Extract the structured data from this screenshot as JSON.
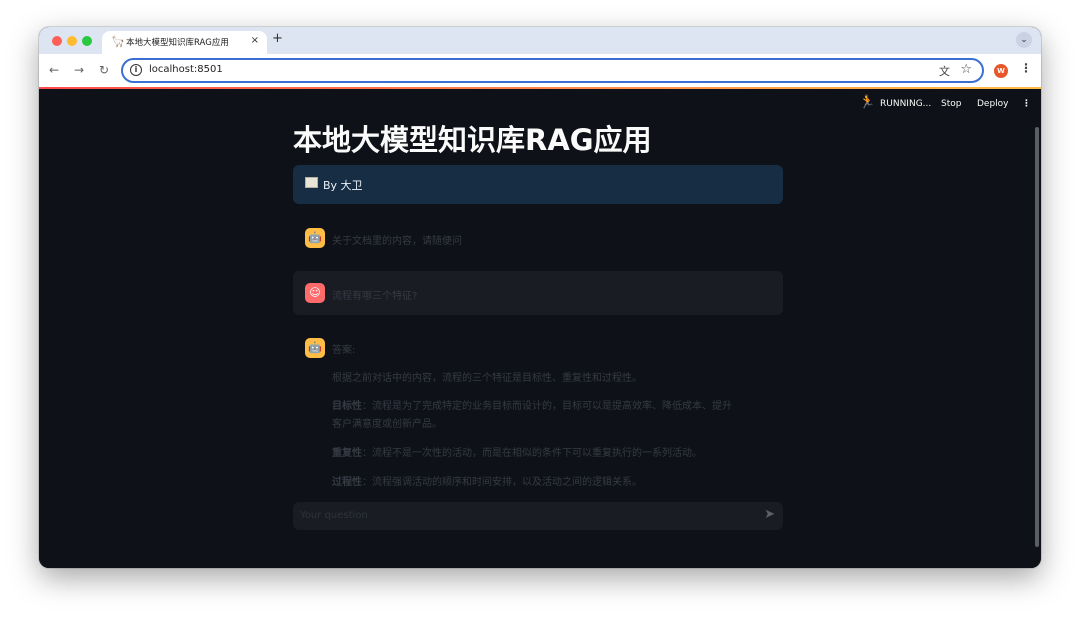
{
  "browser": {
    "tab_title": "本地大模型知识库RAG应用",
    "tab_close": "×",
    "new_tab": "+",
    "url": "localhost:8501",
    "profile_initial": "W",
    "traffic_colors": [
      "#ff5f57",
      "#febc2e",
      "#28c840"
    ]
  },
  "header": {
    "status": "RUNNING...",
    "stop_label": "Stop",
    "deploy_label": "Deploy"
  },
  "page": {
    "title": "本地大模型知识库RAG应用",
    "info": "By 大卫"
  },
  "chat": {
    "greeting": "关于文档里的内容，请随便问",
    "user_question": "流程有哪三个特征?",
    "answer_heading": "答案:",
    "answer_intro": "根据之前对话中的内容，流程的三个特征是目标性、重复性和过程性。",
    "points": [
      {
        "term": "目标性",
        "text": "：流程是为了完成特定的业务目标而设计的，目标可以是提高效率、降低成本、提升"
      },
      {
        "term": "",
        "text": "客户满意度或创新产品。"
      },
      {
        "term": "重复性",
        "text": "：流程不是一次性的活动，而是在相似的条件下可以重复执行的一系列活动。"
      },
      {
        "term": "过程性",
        "text": "：流程强调活动的顺序和时间安排，以及活动之间的逻辑关系。"
      }
    ],
    "input_placeholder": "Your question"
  }
}
